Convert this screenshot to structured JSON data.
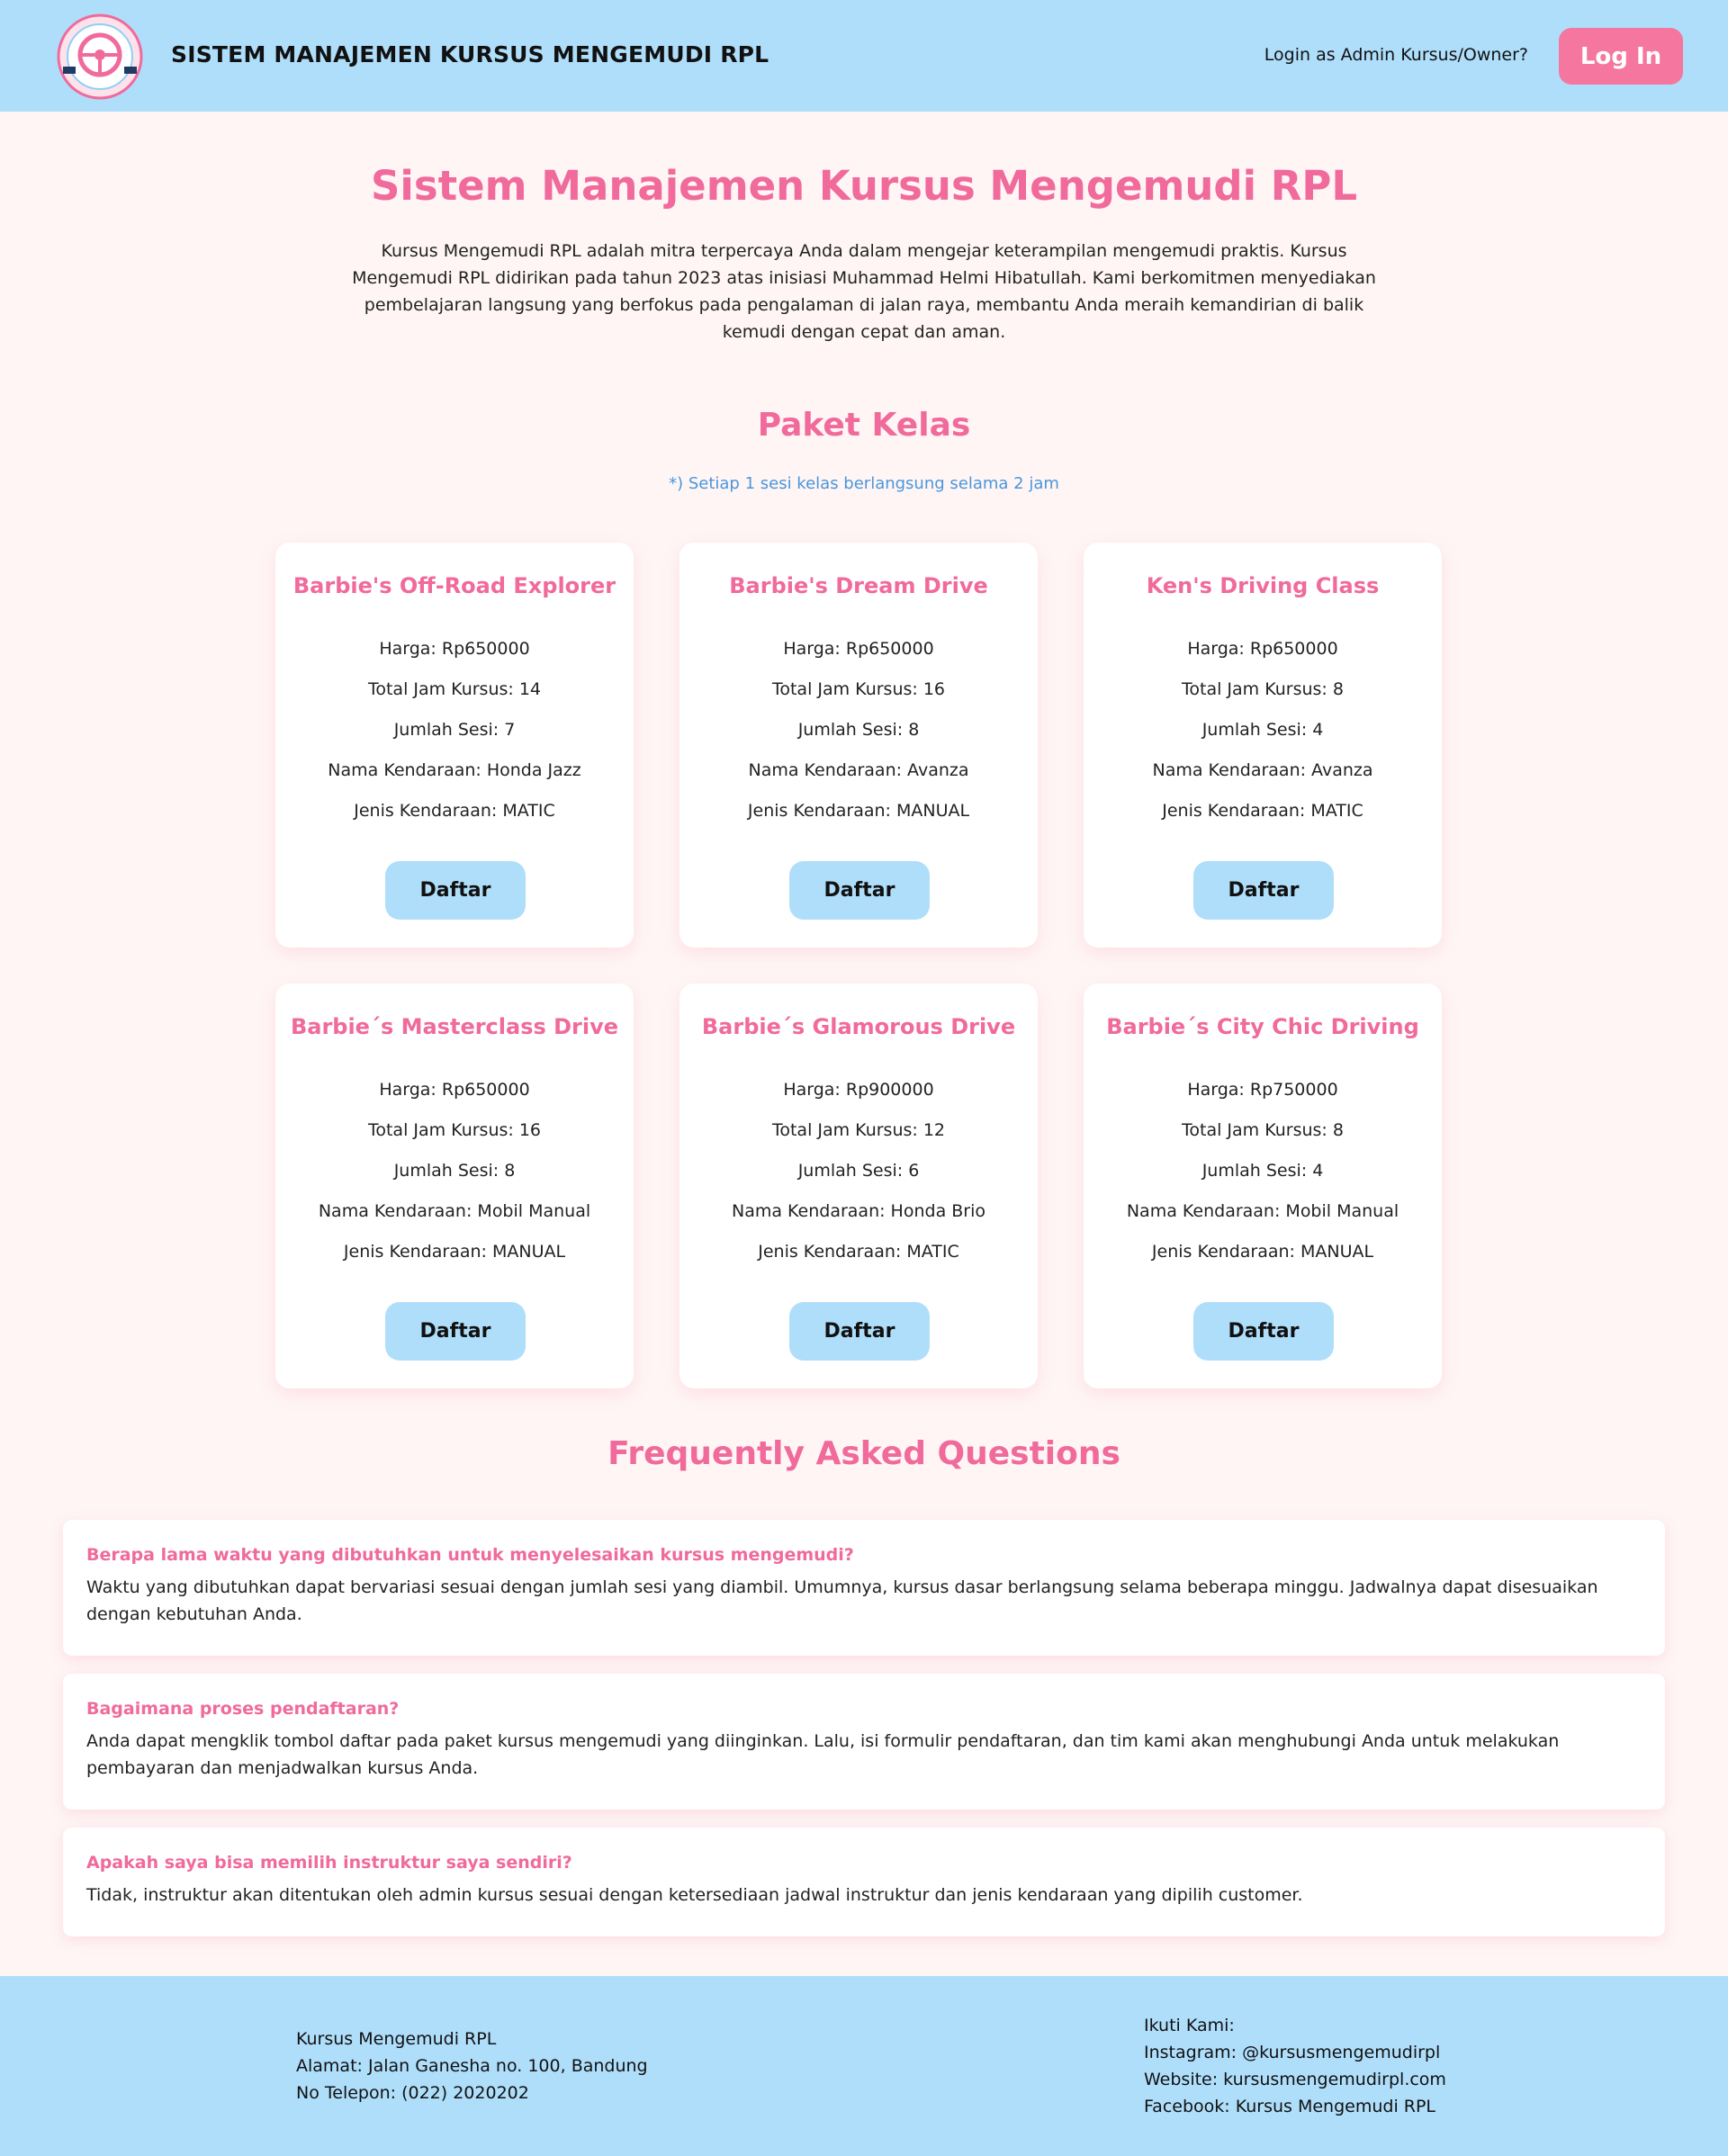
{
  "header": {
    "logo_text": "KURSUS MENGEMUDI RPL",
    "title": "SISTEM MANAJEMEN KURSUS MENGEMUDI RPL",
    "login_hint": "Login as Admin Kursus/Owner?",
    "login_label": "Log In"
  },
  "hero": {
    "title": "Sistem Manajemen Kursus Mengemudi RPL",
    "description": "Kursus Mengemudi RPL adalah mitra terpercaya Anda dalam mengejar keterampilan mengemudi praktis. Kursus Mengemudi RPL didirikan pada tahun 2023 atas inisiasi Muhammad Helmi Hibatullah. Kami berkomitmen menyediakan pembelajaran langsung yang berfokus pada pengalaman di jalan raya, membantu Anda meraih kemandirian di balik kemudi dengan cepat dan aman."
  },
  "packages": {
    "title": "Paket Kelas",
    "note": "*) Setiap 1 sesi kelas berlangsung selama 2 jam",
    "button_label": "Daftar",
    "items": [
      {
        "name": "Barbie's Off-Road Explorer",
        "harga": "Harga: Rp650000",
        "jam": "Total Jam Kursus: 14",
        "sesi": "Jumlah Sesi: 7",
        "kendaraan": "Nama Kendaraan: Honda Jazz",
        "jenis": "Jenis Kendaraan: MATIC"
      },
      {
        "name": "Barbie's Dream Drive",
        "harga": "Harga: Rp650000",
        "jam": "Total Jam Kursus: 16",
        "sesi": "Jumlah Sesi: 8",
        "kendaraan": "Nama Kendaraan: Avanza",
        "jenis": "Jenis Kendaraan: MANUAL"
      },
      {
        "name": "Ken's Driving Class",
        "harga": "Harga: Rp650000",
        "jam": "Total Jam Kursus: 8",
        "sesi": "Jumlah Sesi: 4",
        "kendaraan": "Nama Kendaraan: Avanza",
        "jenis": "Jenis Kendaraan: MATIC"
      },
      {
        "name": "Barbie´s Masterclass Drive",
        "harga": "Harga: Rp650000",
        "jam": "Total Jam Kursus: 16",
        "sesi": "Jumlah Sesi: 8",
        "kendaraan": "Nama Kendaraan: Mobil Manual",
        "jenis": "Jenis Kendaraan: MANUAL"
      },
      {
        "name": "Barbie´s Glamorous Drive",
        "harga": "Harga: Rp900000",
        "jam": "Total Jam Kursus: 12",
        "sesi": "Jumlah Sesi: 6",
        "kendaraan": "Nama Kendaraan: Honda Brio",
        "jenis": "Jenis Kendaraan: MATIC"
      },
      {
        "name": "Barbie´s City Chic Driving",
        "harga": "Harga: Rp750000",
        "jam": "Total Jam Kursus: 8",
        "sesi": "Jumlah Sesi: 4",
        "kendaraan": "Nama Kendaraan: Mobil Manual",
        "jenis": "Jenis Kendaraan: MANUAL"
      }
    ]
  },
  "faq": {
    "title": "Frequently Asked Questions",
    "items": [
      {
        "q": "Berapa lama waktu yang dibutuhkan untuk menyelesaikan kursus mengemudi?",
        "a": "Waktu yang dibutuhkan dapat bervariasi sesuai dengan jumlah sesi yang diambil. Umumnya, kursus dasar berlangsung selama beberapa minggu. Jadwalnya dapat disesuaikan dengan kebutuhan Anda."
      },
      {
        "q": "Bagaimana proses pendaftaran?",
        "a": "Anda dapat mengklik tombol daftar pada paket kursus mengemudi yang diinginkan. Lalu, isi formulir pendaftaran, dan tim kami akan menghubungi Anda untuk melakukan pembayaran dan menjadwalkan kursus Anda."
      },
      {
        "q": "Apakah saya bisa memilih instruktur saya sendiri?",
        "a": "Tidak, instruktur akan ditentukan oleh admin kursus sesuai dengan ketersediaan jadwal instruktur dan jenis kendaraan yang dipilih customer."
      }
    ]
  },
  "footer": {
    "name": "Kursus Mengemudi RPL",
    "alamat": "Alamat: Jalan Ganesha no. 100, Bandung",
    "telepon": "No Telepon: (022) 2020202",
    "follow": "Ikuti Kami:",
    "instagram": "Instagram: @kursusmengemudirpl",
    "website": "Website: kursusmengemudirpl.com",
    "facebook": "Facebook: Kursus Mengemudi RPL"
  },
  "colors": {
    "header_bg": "#afdefb",
    "accent_pink": "#f06a9b",
    "button_pink": "#f5779f",
    "page_bg": "#fff5f5",
    "note_blue": "#4a96dc"
  },
  "icons": {
    "logo": "steering-wheel-badge-icon"
  }
}
